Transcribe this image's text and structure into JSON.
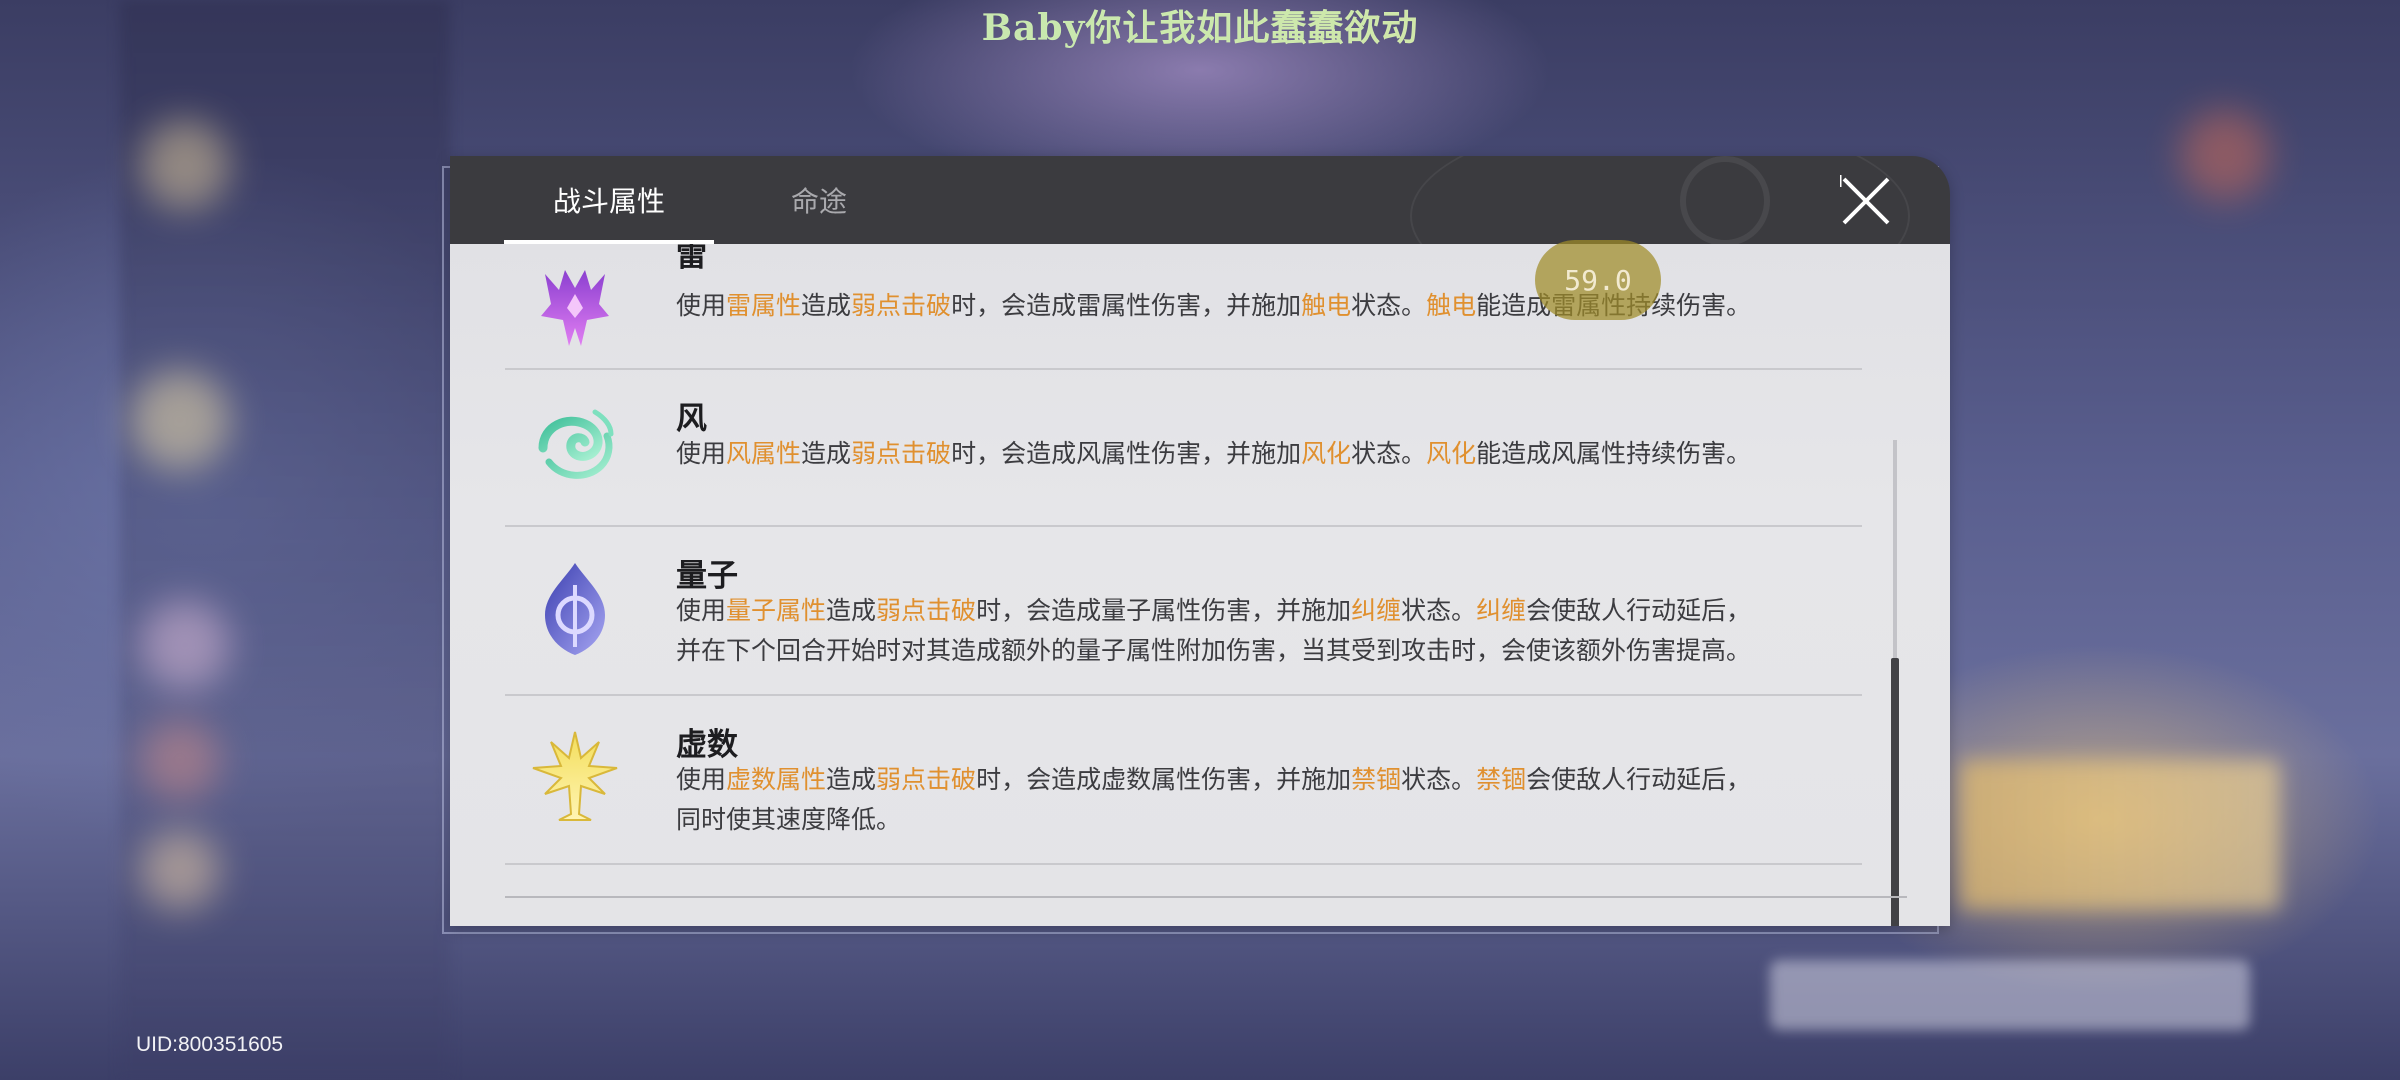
{
  "overlay_caption": "Baby你让我如此蠢蠢欲动",
  "uid": "UID:800351605",
  "fps_badge": "59.0",
  "tabs": [
    {
      "label": "战斗属性",
      "active": true
    },
    {
      "label": "命途",
      "active": false
    }
  ],
  "icons": {
    "close": "close-x-icon"
  },
  "colors": {
    "highlight": "#e0902f",
    "header": "#3b3b3f",
    "panel": "#e3e3e6"
  },
  "elements": [
    {
      "name": "雷",
      "icon": "lightning-element-icon",
      "desc_parts": [
        "使用",
        "雷属性",
        "造成",
        "弱点击破",
        "时，会造成雷属性伤害，并施加",
        "触电",
        "状态。",
        "触电",
        "能造成雷属性持续伤害。"
      ]
    },
    {
      "name": "风",
      "icon": "wind-element-icon",
      "desc_parts": [
        "使用",
        "风属性",
        "造成",
        "弱点击破",
        "时，会造成风属性伤害，并施加",
        "风化",
        "状态。",
        "风化",
        "能造成风属性持续伤害。"
      ]
    },
    {
      "name": "量子",
      "icon": "quantum-element-icon",
      "desc_parts": [
        "使用",
        "量子属性",
        "造成",
        "弱点击破",
        "时，会造成量子属性伤害，并施加",
        "纠缠",
        "状态。",
        "纠缠",
        "会使敌人行动延后，",
        "并在下个回合开始时对其造成额外的量子属性附加伤害，当其受到攻击时，会使该额外伤害提高。"
      ]
    },
    {
      "name": "虚数",
      "icon": "imaginary-element-icon",
      "desc_parts": [
        "使用",
        "虚数属性",
        "造成",
        "弱点击破",
        "时，会造成虚数属性伤害，并施加",
        "禁锢",
        "状态。",
        "禁锢",
        "会使敌人行动延后，",
        "同时使其速度降低。"
      ]
    }
  ]
}
